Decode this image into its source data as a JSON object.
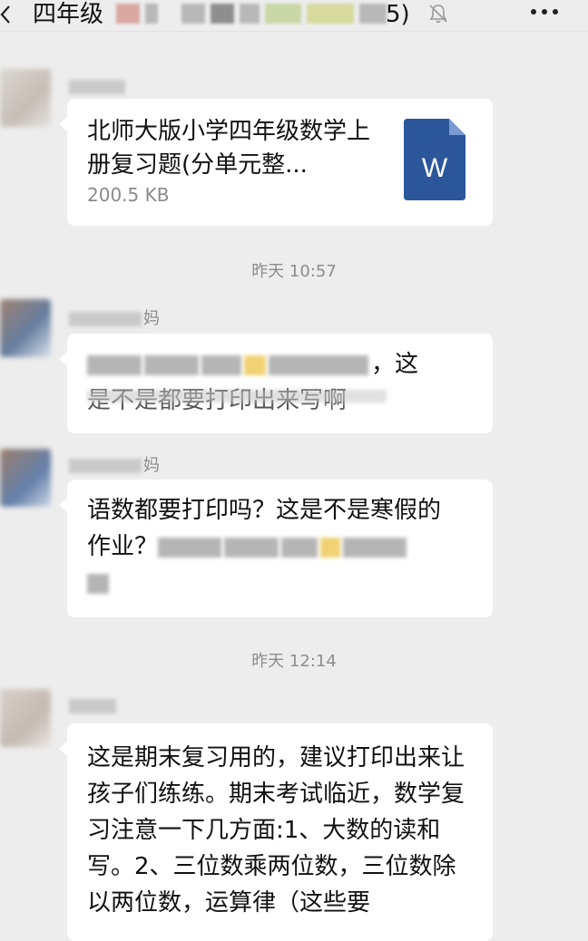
{
  "header": {
    "title": "四年级",
    "title_suffix": "5)"
  },
  "messages": [
    {
      "id": "file",
      "file": {
        "name": "北师大版小学四年级数学上册复习题(分单元整...",
        "size": "200.5 KB",
        "icon_letter": "W"
      }
    },
    {
      "id": "ts1",
      "timestamp": "昨天 10:57"
    },
    {
      "id": "m2",
      "sender_suffix": "妈",
      "text_end": "，这",
      "text_line2": "是不是都要打印出来写啊"
    },
    {
      "id": "m3",
      "sender_suffix": "妈",
      "text": "语数都要打印吗？这是不是寒假的",
      "text_line2": "作业？"
    },
    {
      "id": "ts2",
      "timestamp": "昨天 12:14"
    },
    {
      "id": "m4",
      "text": "这是期末复习用的，建议打印出来让孩子们练练。期末考试临近，数学复习注意一下几方面:1、大数的读和写。2、三位数乘两位数，三位数除以两位数，运算律（这些要"
    }
  ],
  "colors": {
    "background": "#ededed",
    "bubble": "#ffffff",
    "word_icon": "#2b579a"
  }
}
